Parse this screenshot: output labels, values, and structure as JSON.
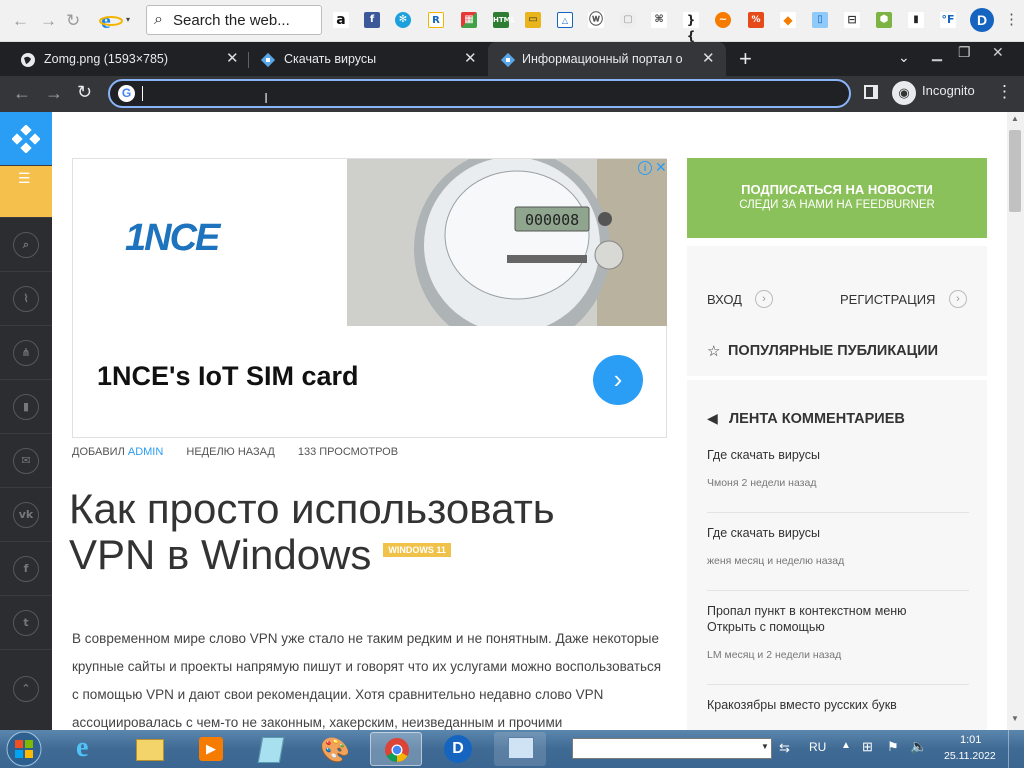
{
  "bookmarks": {
    "search_placeholder": "Search the web..."
  },
  "tabs": [
    {
      "label": "Zomg.png (1593×785)"
    },
    {
      "label": "Скачать вирусы"
    },
    {
      "label": "Информационный портал о Wi"
    }
  ],
  "toolbar": {
    "omnibox_value": "",
    "incognito_label": "Incognito"
  },
  "ad": {
    "brand": "1NCE",
    "meter_display": "000008",
    "headline": "1NCE's IoT SIM card"
  },
  "article": {
    "meta_prefix": "ДОБАВИЛ",
    "author": "ADMIN",
    "time": "НЕДЕЛЮ НАЗАД",
    "views": "133 ПРОСМОТРОВ",
    "title": "Как просто использовать VPN в Windows",
    "badge": "WINDOWS 11",
    "body": "В современном мире слово VPN уже стало не таким редким и не понятным. Даже некоторые крупные сайты и проекты напрямую пишут и говорят что их услугами можно воспользоваться с помощью VPN и дают свои рекомендации. Хотя сравнительно недавно слово VPN ассоциировалась с чем-то не законным, хакерским, неизведанным и прочими"
  },
  "sidebar": {
    "subscribe_line1": "ПОДПИСАТЬСЯ НА НОВОСТИ",
    "subscribe_line2": "СЛЕДИ ЗА НАМИ НА FEEDBURNER",
    "login": "ВХОД",
    "register": "РЕГИСТРАЦИЯ",
    "popular_title": "ПОПУЛЯРНЫЕ ПУБЛИКАЦИИ",
    "comments_title": "ЛЕНТА КОММЕНТАРИЕВ",
    "comments": [
      {
        "title": "Где скачать вирусы",
        "meta": "Чмоня 2 недели назад"
      },
      {
        "title": "Где скачать вирусы",
        "meta": "женя месяц и неделю назад"
      },
      {
        "title": "Пропал пункт в контекстном меню Открыть с помощью",
        "meta": "LM месяц и 2 недели назад"
      },
      {
        "title": "Кракозябры вместо русских букв",
        "meta": ""
      }
    ]
  },
  "taskbar": {
    "language": "RU",
    "time": "1:01",
    "date": "25.11.2022"
  },
  "colors": {
    "accent_blue": "#2a9df4",
    "subscribe_green": "#8bc15a",
    "sidebar_dark": "#2b2d30",
    "yellow_active": "#f5c04c"
  }
}
